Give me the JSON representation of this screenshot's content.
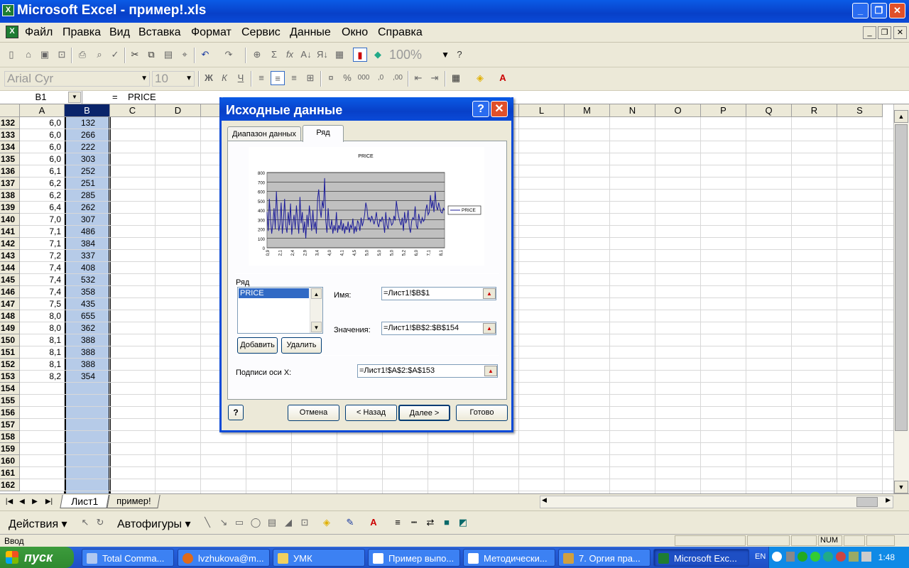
{
  "window": {
    "title": "Microsoft Excel - пример!.xls",
    "icon": "excel-icon"
  },
  "menu": [
    "Файл",
    "Правка",
    "Вид",
    "Вставка",
    "Формат",
    "Сервис",
    "Данные",
    "Окно",
    "Справка"
  ],
  "formatting": {
    "font": "Arial Cyr",
    "size": "10",
    "zoom": "100%"
  },
  "formula_bar": {
    "cell": "B1",
    "eq": "=",
    "content": "PRICE"
  },
  "columns": [
    "A",
    "B",
    "C",
    "D",
    "E",
    "F",
    "G",
    "H",
    "I",
    "J",
    "K",
    "L",
    "M",
    "N",
    "O",
    "P",
    "Q",
    "R",
    "S"
  ],
  "rows": [
    {
      "n": "132",
      "a": "6,0",
      "b": "132"
    },
    {
      "n": "133",
      "a": "6,0",
      "b": "266"
    },
    {
      "n": "134",
      "a": "6,0",
      "b": "222"
    },
    {
      "n": "135",
      "a": "6,0",
      "b": "303"
    },
    {
      "n": "136",
      "a": "6,1",
      "b": "252"
    },
    {
      "n": "137",
      "a": "6,2",
      "b": "251"
    },
    {
      "n": "138",
      "a": "6,2",
      "b": "285"
    },
    {
      "n": "139",
      "a": "6,4",
      "b": "262"
    },
    {
      "n": "140",
      "a": "7,0",
      "b": "307"
    },
    {
      "n": "141",
      "a": "7,1",
      "b": "486"
    },
    {
      "n": "142",
      "a": "7,1",
      "b": "384"
    },
    {
      "n": "143",
      "a": "7,2",
      "b": "337"
    },
    {
      "n": "144",
      "a": "7,4",
      "b": "408"
    },
    {
      "n": "145",
      "a": "7,4",
      "b": "532"
    },
    {
      "n": "146",
      "a": "7,4",
      "b": "358"
    },
    {
      "n": "147",
      "a": "7,5",
      "b": "435"
    },
    {
      "n": "148",
      "a": "8,0",
      "b": "655"
    },
    {
      "n": "149",
      "a": "8,0",
      "b": "362"
    },
    {
      "n": "150",
      "a": "8,1",
      "b": "388"
    },
    {
      "n": "151",
      "a": "8,1",
      "b": "388"
    },
    {
      "n": "152",
      "a": "8,1",
      "b": "388"
    },
    {
      "n": "153",
      "a": "8,2",
      "b": "354"
    },
    {
      "n": "154",
      "a": "",
      "b": ""
    },
    {
      "n": "155",
      "a": "",
      "b": ""
    },
    {
      "n": "156",
      "a": "",
      "b": ""
    },
    {
      "n": "157",
      "a": "",
      "b": ""
    },
    {
      "n": "158",
      "a": "",
      "b": ""
    },
    {
      "n": "159",
      "a": "",
      "b": ""
    },
    {
      "n": "160",
      "a": "",
      "b": ""
    },
    {
      "n": "161",
      "a": "",
      "b": ""
    },
    {
      "n": "162",
      "a": "",
      "b": ""
    }
  ],
  "sheet_tabs": [
    "Лист1",
    "пример!"
  ],
  "drawing": {
    "actions": "Действия",
    "autoshapes": "Автофигуры"
  },
  "status": {
    "mode": "Ввод",
    "num": "NUM"
  },
  "dialog": {
    "title": "Исходные данные",
    "tabs": [
      "Диапазон данных",
      "Ряд"
    ],
    "series_group": "Ряд",
    "series_list": [
      "PRICE"
    ],
    "name_label": "Имя:",
    "name_value": "=Лист1!$B$1",
    "values_label": "Значения:",
    "values_value": "=Лист1!$B$2:$B$154",
    "xlabels_label": "Подписи оси X:",
    "xlabels_value": "=Лист1!$A$2:$A$153",
    "add_button": "Добавить",
    "remove_button": "Удалить",
    "cancel_button": "Отмена",
    "back_button": "< Назад",
    "next_button": "Далее >",
    "finish_button": "Готово"
  },
  "chart_data": {
    "type": "line",
    "title": "PRICE",
    "legend": "right",
    "grid": true,
    "ylim": [
      0,
      800
    ],
    "yticks": [
      0,
      100,
      200,
      300,
      400,
      500,
      600,
      700,
      800
    ],
    "xticks": [
      "0,9",
      "2,1",
      "2,4",
      "2,9",
      "3,4",
      "4,0",
      "4,1",
      "4,5",
      "5,0",
      "5,0",
      "5,0",
      "5,2",
      "6,0",
      "7,1",
      "8,1"
    ],
    "series": [
      {
        "name": "PRICE",
        "color": "#1c1c9a",
        "values": [
          380,
          180,
          520,
          300,
          150,
          260,
          420,
          200,
          600,
          340,
          180,
          250,
          480,
          150,
          300,
          520,
          230,
          160,
          380,
          240,
          470,
          140,
          260,
          350,
          200,
          450,
          300,
          150,
          540,
          260,
          380,
          160,
          280,
          100,
          350,
          220,
          450,
          320,
          180,
          400,
          200,
          280,
          150,
          520,
          620,
          420,
          320,
          500,
          420,
          740,
          280,
          160,
          420,
          240,
          200,
          300,
          150,
          240,
          180,
          380,
          160,
          240,
          200,
          300,
          180,
          260,
          150,
          230,
          190,
          280,
          160,
          240,
          210,
          310,
          150,
          230,
          170,
          290,
          260,
          180,
          320,
          230,
          280,
          350,
          480,
          420,
          300,
          320,
          280,
          340,
          300,
          250,
          300,
          380,
          260,
          220,
          300,
          280,
          330,
          270,
          160,
          380,
          240,
          200,
          320,
          300,
          240,
          260,
          340,
          290,
          500,
          400,
          330,
          280,
          240,
          320,
          180,
          380,
          260,
          300,
          400,
          220,
          160,
          280,
          320,
          300,
          440,
          240,
          200,
          360,
          290,
          260,
          320,
          280,
          300,
          400,
          460,
          350,
          380,
          560,
          420,
          500,
          380,
          600,
          440,
          400,
          480,
          420,
          380,
          370,
          420,
          400
        ]
      }
    ]
  },
  "taskbar": {
    "start": "пуск",
    "tasks": [
      "Total Comma...",
      "lvzhukova@m...",
      "УМК",
      "Пример выпо...",
      "Методически...",
      "7. Оргия пра...",
      "Microsoft Exc..."
    ],
    "lang": "EN",
    "clock": "1:48"
  }
}
